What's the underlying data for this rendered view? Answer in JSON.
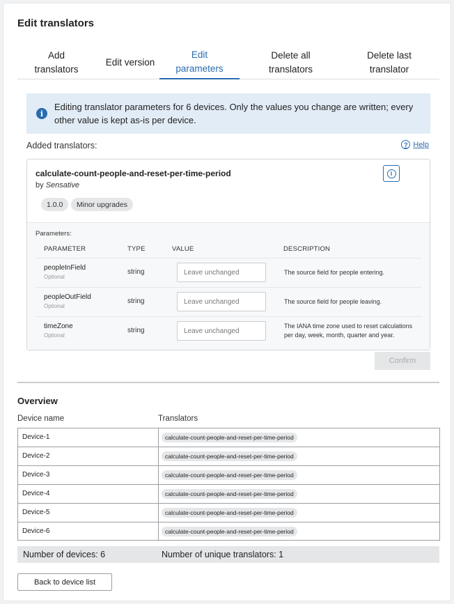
{
  "header": {
    "title": "Edit translators"
  },
  "tabs": [
    {
      "label": "Add\ntranslators"
    },
    {
      "label": "Edit version"
    },
    {
      "label": "Edit\nparameters"
    },
    {
      "label": "Delete all\ntranslators"
    },
    {
      "label": "Delete last\ntranslator"
    }
  ],
  "active_tab": "Edit parameters",
  "info": {
    "text": "Editing translator parameters for 6 devices. Only the values you change are written; every other value is kept as-is per device.",
    "icon": "info-icon"
  },
  "added": {
    "label": "Added translators:",
    "help": "Help"
  },
  "translator": {
    "name": "calculate-count-people-and-reset-per-time-period",
    "by_prefix": "by",
    "author": "Sensative",
    "version": "1.0.0",
    "upgrade": "Minor upgrades"
  },
  "params": {
    "label": "Parameters:",
    "headers": {
      "parameter": "PARAMETER",
      "type": "TYPE",
      "value": "VALUE",
      "description": "DESCRIPTION"
    },
    "rows": [
      {
        "name": "peopleInField",
        "optional": "Optional",
        "type": "string",
        "placeholder": "Leave unchanged",
        "description": "The source field for people entering."
      },
      {
        "name": "peopleOutField",
        "optional": "Optional",
        "type": "string",
        "placeholder": "Leave unchanged",
        "description": "The source field for people leaving."
      },
      {
        "name": "timeZone",
        "optional": "Optional",
        "type": "string",
        "placeholder": "Leave unchanged",
        "description": "The IANA time zone used to reset calculations per day, week, month, quarter and year."
      }
    ]
  },
  "confirm_label": "Confirm",
  "overview": {
    "title": "Overview",
    "col_device": "Device name",
    "col_translators": "Translators",
    "rows": [
      {
        "device": "Device-1",
        "translator": "calculate-count-people-and-reset-per-time-period"
      },
      {
        "device": "Device-2",
        "translator": "calculate-count-people-and-reset-per-time-period"
      },
      {
        "device": "Device-3",
        "translator": "calculate-count-people-and-reset-per-time-period"
      },
      {
        "device": "Device-4",
        "translator": "calculate-count-people-and-reset-per-time-period"
      },
      {
        "device": "Device-5",
        "translator": "calculate-count-people-and-reset-per-time-period"
      },
      {
        "device": "Device-6",
        "translator": "calculate-count-people-and-reset-per-time-period"
      }
    ],
    "num_devices": "Number of devices: 6",
    "num_unique": "Number of unique translators: 1"
  },
  "back_label": "Back to device list",
  "colors": {
    "accent": "#2a6bb0",
    "info_bg": "#e2ecf6",
    "badge_bg": "#e4e6e8"
  }
}
